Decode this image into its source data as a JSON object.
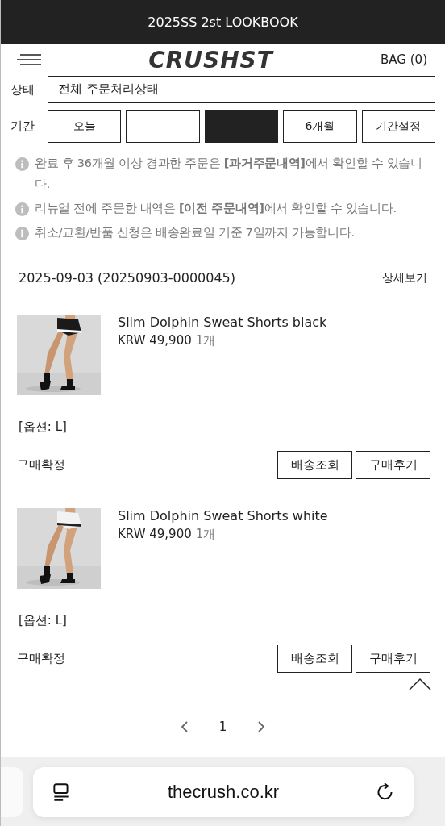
{
  "top_bar": {
    "title": "2025SS 2st LOOKBOOK"
  },
  "header": {
    "logo": "CRUSHST",
    "bag": "BAG (0)"
  },
  "filter": {
    "status_label": "상태",
    "status_value": "전체 주문처리상태",
    "period_label": "기간",
    "periods": [
      {
        "label": "오늘",
        "selected": false
      },
      {
        "selected": false
      },
      {
        "selected": true
      },
      {
        "label": "6개월",
        "selected": false
      },
      {
        "label": "기간설정",
        "selected": false
      }
    ]
  },
  "notes": [
    "완료 후 36개월 이상 경과한 주문은 **[과거주문내역]**에서 확인할 수 있습니다.",
    "리뉴얼 전에 주문한 내역은 **[이전 주문내역]**에서 확인할 수 있습니다.",
    "취소/교환/반품 신청은 배송완료일 기준 7일까지 가능합니다."
  ],
  "order": {
    "date": "2025-09-03 (20250903-0000045)",
    "detail_link": "상세보기",
    "items": [
      {
        "kind": "picture",
        "name": "Slim Dolphin Sweat Shorts black",
        "price": "KRW 49,900",
        "qty": "1개",
        "option": "[옵션: L]",
        "status": "구매확정",
        "buttons": [
          "배송조회",
          "구매후기"
        ]
      },
      {
        "kind": "picture",
        "name": "Slim Dolphin Sweat Shorts white",
        "price": "KRW 49,900",
        "qty": "1개",
        "option": "[옵션: L]",
        "status": "구매확정",
        "buttons": [
          "배송조회",
          "구매후기"
        ]
      }
    ]
  },
  "pagination": {
    "page": "1"
  },
  "browser": {
    "url": "thecrush.co.kr"
  }
}
